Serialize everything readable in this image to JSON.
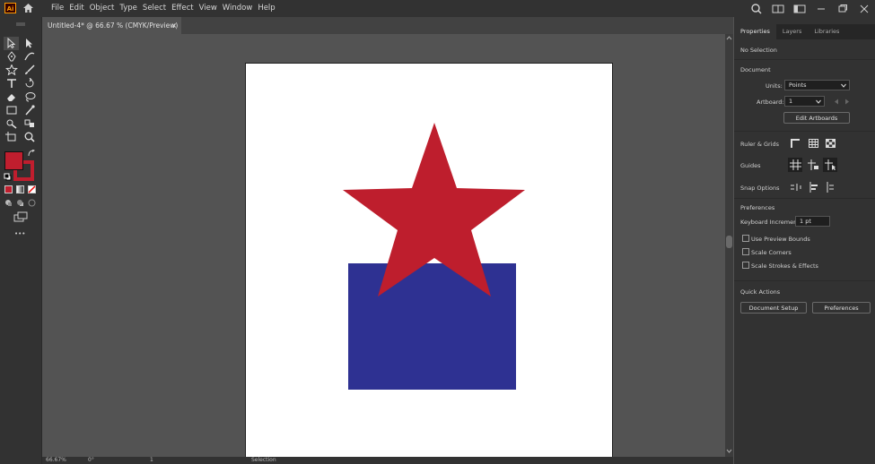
{
  "app": {
    "logo_text": "Ai"
  },
  "menu": [
    "File",
    "Edit",
    "Object",
    "Type",
    "Select",
    "Effect",
    "View",
    "Window",
    "Help"
  ],
  "document_tab": {
    "title": "Untitled-4* @ 66.67 % (CMYK/Preview)",
    "close": "×"
  },
  "toolbar": {
    "more": "•••"
  },
  "status": {
    "zoom": "66.67%",
    "rotation": "0°",
    "artboard": "1",
    "tool": "Selection"
  },
  "panel": {
    "tabs": [
      "Properties",
      "Layers",
      "Libraries"
    ],
    "selection": "No Selection",
    "document_label": "Document",
    "units_label": "Units:",
    "units_value": "Points",
    "artboard_label": "Artboard:",
    "artboard_value": "1",
    "edit_artboards": "Edit Artboards",
    "ruler_grids": "Ruler & Grids",
    "guides": "Guides",
    "snap_options": "Snap Options",
    "preferences_label": "Preferences",
    "keyboard_increment_label": "Keyboard Increment:",
    "keyboard_increment_value": "1 pt",
    "use_preview_bounds": "Use Preview Bounds",
    "scale_corners": "Scale Corners",
    "scale_strokes": "Scale Strokes & Effects",
    "quick_actions": "Quick Actions",
    "document_setup": "Document Setup",
    "preferences_button": "Preferences"
  },
  "colors": {
    "fill": "#c01e2e",
    "star": "#be1e2d",
    "rect": "#2e3192",
    "accent": "#ff9a00"
  }
}
